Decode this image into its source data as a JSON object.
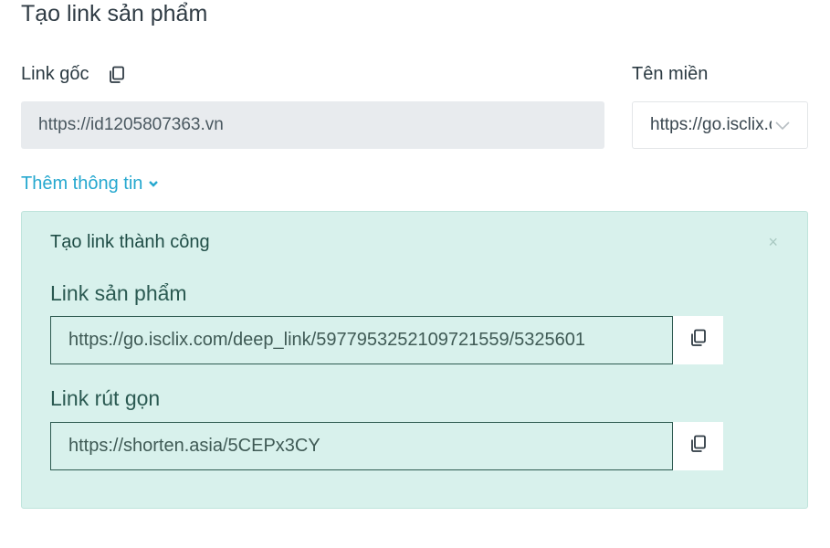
{
  "page": {
    "title": "Tạo link sản phẩm"
  },
  "origin": {
    "label": "Link gốc",
    "value": "https://id1205807363.vn"
  },
  "domain": {
    "label": "Tên miền",
    "selected": "https://go.isclix.com"
  },
  "more_info": {
    "label": "Thêm thông tin"
  },
  "result": {
    "title": "Tạo link thành công",
    "close": "×",
    "product_link": {
      "label": "Link sản phẩm",
      "value": "https://go.isclix.com/deep_link/5977953252109721559/5325601"
    },
    "short_link": {
      "label": "Link rút gọn",
      "value": "https://shorten.asia/5CEPx3CY"
    }
  },
  "icons": [
    "copy-icon",
    "chevron-down-icon",
    "close-icon"
  ]
}
